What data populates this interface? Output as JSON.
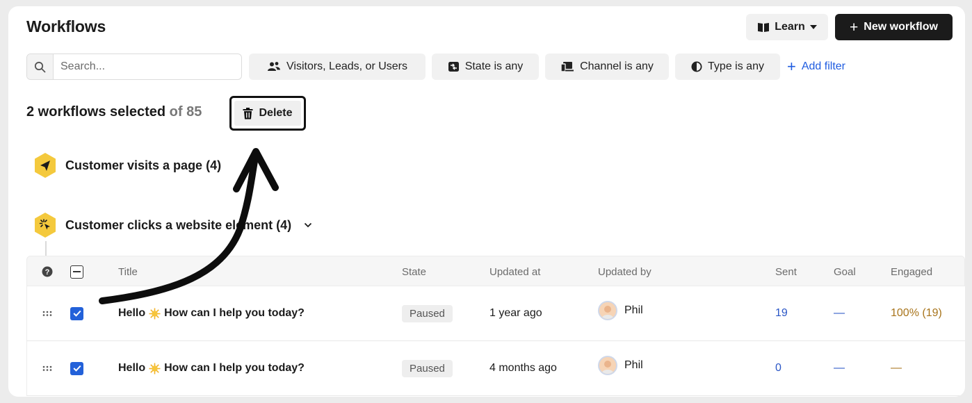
{
  "header": {
    "title": "Workflows",
    "learn_label": "Learn",
    "new_workflow_label": "New workflow"
  },
  "search": {
    "placeholder": "Search...",
    "value": ""
  },
  "filters": {
    "audience": "Visitors, Leads, or Users",
    "state": "State is any",
    "channel": "Channel is any",
    "type": "Type is any",
    "add_filter": "Add filter"
  },
  "selection": {
    "selected_text": "2 workflows selected",
    "of_total": "of 85",
    "delete_label": "Delete"
  },
  "groups": [
    {
      "label": "Customer visits a page (4)",
      "icon": "paper-plane-icon"
    },
    {
      "label": "Customer clicks a website element (4)",
      "icon": "click-cursor-icon"
    }
  ],
  "table": {
    "columns": {
      "title": "Title",
      "state": "State",
      "updated_at": "Updated at",
      "updated_by": "Updated by",
      "sent": "Sent",
      "goal": "Goal",
      "engaged": "Engaged"
    },
    "rows": [
      {
        "title_prefix": "Hello",
        "title_suffix": "How can I help you today?",
        "state": "Paused",
        "updated_at": "1 year ago",
        "updated_by": "Phil",
        "sent": "19",
        "goal": "—",
        "engaged": "100% (19)",
        "checked": true
      },
      {
        "title_prefix": "Hello",
        "title_suffix": "How can I help you today?",
        "state": "Paused",
        "updated_at": "4 months ago",
        "updated_by": "Phil",
        "sent": "0",
        "goal": "—",
        "engaged": "—",
        "checked": true
      }
    ]
  },
  "colors": {
    "primary_button": "#1b1b1b",
    "link_blue": "#1f5ce0",
    "checkbox_blue": "#2361d9",
    "hex_yellow": "#f4c93d",
    "engaged_gold": "#a8741b"
  }
}
